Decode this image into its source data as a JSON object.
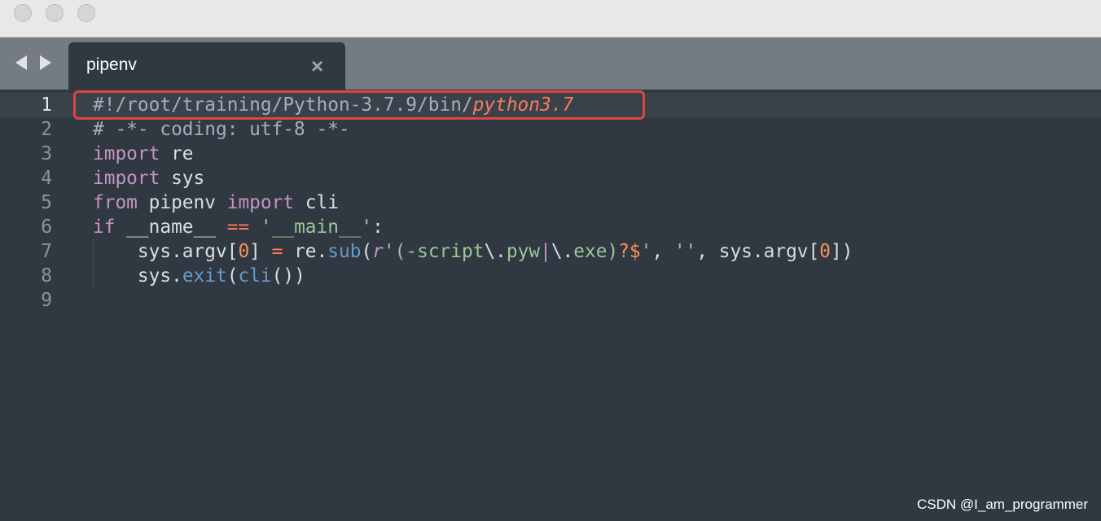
{
  "window": {
    "tab_title": "pipenv",
    "tab_close": "×"
  },
  "colors": {
    "comment": "#a7adba",
    "keyword": "#c594c5",
    "string": "#99c794",
    "number": "#f99157",
    "function": "#6699cc",
    "operator": "#f97b58",
    "default": "#d8dee9",
    "highlight_box": "#e0443b"
  },
  "editor": {
    "current_line": 1,
    "lines": [
      {
        "num": "1",
        "tokens": [
          [
            "#!/root/training/Python-3.7.9/bin/",
            "comment"
          ],
          [
            "python3.7",
            "shebang-italic"
          ]
        ]
      },
      {
        "num": "2",
        "tokens": [
          [
            "# -*- coding: utf-8 -*-",
            "comment"
          ]
        ]
      },
      {
        "num": "3",
        "tokens": [
          [
            "import",
            "keyword"
          ],
          [
            " re",
            "default"
          ]
        ]
      },
      {
        "num": "4",
        "tokens": [
          [
            "import",
            "keyword"
          ],
          [
            " sys",
            "default"
          ]
        ]
      },
      {
        "num": "5",
        "tokens": [
          [
            "from",
            "keyword"
          ],
          [
            " pipenv ",
            "default"
          ],
          [
            "import",
            "keyword"
          ],
          [
            " cli",
            "default"
          ]
        ]
      },
      {
        "num": "6",
        "tokens": [
          [
            "if",
            "keyword"
          ],
          [
            " __name__ ",
            "default"
          ],
          [
            "==",
            "operator"
          ],
          [
            " ",
            "default"
          ],
          [
            "'__main__'",
            "string"
          ],
          [
            ":",
            "default"
          ]
        ]
      },
      {
        "num": "7",
        "tokens": [
          [
            "    sys.argv[",
            "default"
          ],
          [
            "0",
            "number"
          ],
          [
            "] ",
            "default"
          ],
          [
            "=",
            "operator"
          ],
          [
            " re.",
            "default"
          ],
          [
            "sub",
            "function"
          ],
          [
            "(",
            "default"
          ],
          [
            "r",
            "keyword-italic"
          ],
          [
            "'(-script",
            "string"
          ],
          [
            "\\.",
            "default"
          ],
          [
            "pyw",
            "string"
          ],
          [
            "|",
            "keyword"
          ],
          [
            "\\.",
            "default"
          ],
          [
            "exe)",
            "string"
          ],
          [
            "?$",
            "number"
          ],
          [
            "'",
            "string"
          ],
          [
            ", ",
            "default"
          ],
          [
            "''",
            "string"
          ],
          [
            ", sys.argv[",
            "default"
          ],
          [
            "0",
            "number"
          ],
          [
            "])",
            "default"
          ]
        ]
      },
      {
        "num": "8",
        "tokens": [
          [
            "    sys.",
            "default"
          ],
          [
            "exit",
            "function"
          ],
          [
            "(",
            "default"
          ],
          [
            "cli",
            "function"
          ],
          [
            "())",
            "default"
          ]
        ]
      },
      {
        "num": "9",
        "tokens": []
      }
    ]
  },
  "watermark": "CSDN @I_am_programmer"
}
